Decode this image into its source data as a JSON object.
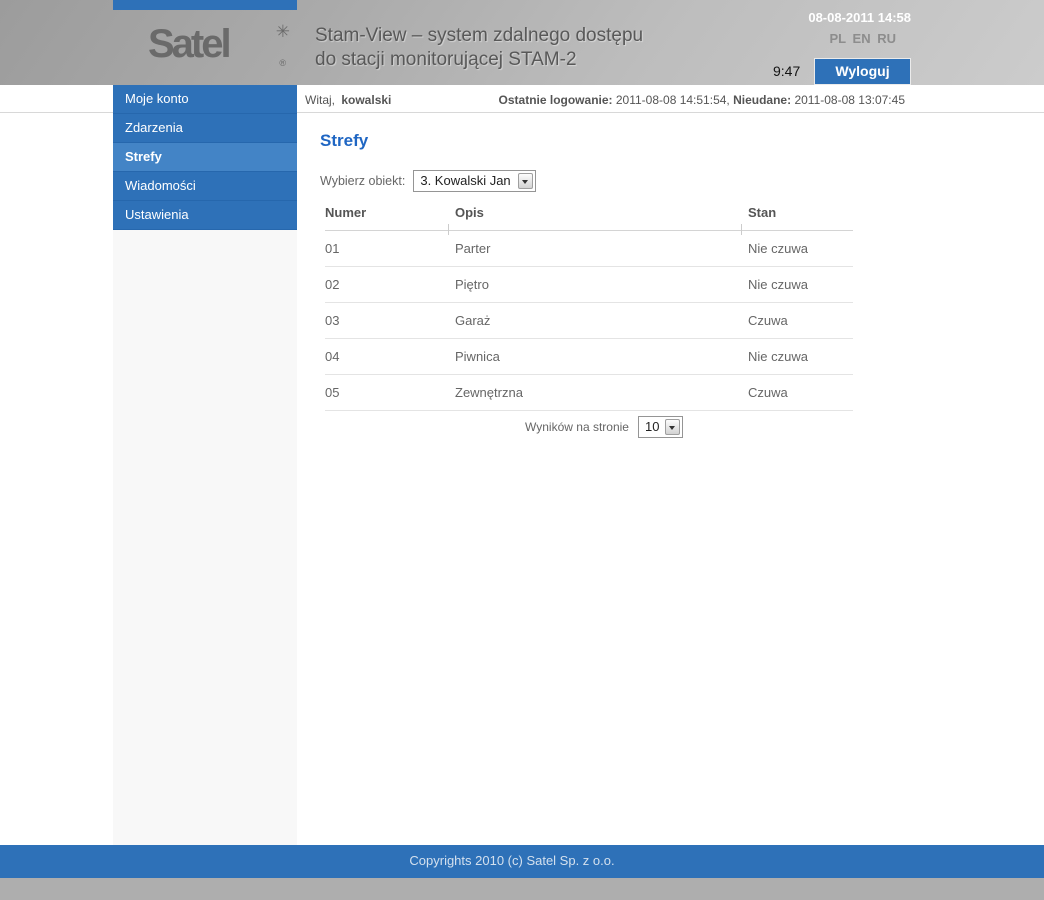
{
  "header": {
    "logo_text": "Satel",
    "logo_asterisk": "✳",
    "logo_registered": "®",
    "title_line1": "Stam-View – system zdalnego dostępu",
    "title_line2": "do stacji monitorującej STAM-2",
    "datetime": "08-08-2011 14:58",
    "languages": [
      "PL",
      "EN",
      "RU"
    ],
    "session_timer": "9:47",
    "logout_label": "Wyloguj"
  },
  "welcome": {
    "greeting_prefix": "Witaj,",
    "username": "kowalski",
    "last_login_label": "Ostatnie logowanie:",
    "last_login_value": "2011-08-08 14:51:54,",
    "failed_label": "Nieudane:",
    "failed_value": "2011-08-08 13:07:45"
  },
  "sidebar": {
    "items": [
      {
        "label": "Moje konto"
      },
      {
        "label": "Zdarzenia"
      },
      {
        "label": "Strefy"
      },
      {
        "label": "Wiadomości"
      },
      {
        "label": "Ustawienia"
      }
    ],
    "active_item": "Strefy"
  },
  "main": {
    "page_title": "Strefy",
    "object_select_label": "Wybierz obiekt:",
    "object_select_value": "3. Kowalski Jan",
    "table": {
      "columns": [
        "Numer",
        "Opis",
        "Stan"
      ],
      "rows": [
        {
          "numer": "01",
          "opis": "Parter",
          "stan": "Nie czuwa"
        },
        {
          "numer": "02",
          "opis": "Piętro",
          "stan": "Nie czuwa"
        },
        {
          "numer": "03",
          "opis": "Garaż",
          "stan": "Czuwa"
        },
        {
          "numer": "04",
          "opis": "Piwnica",
          "stan": "Nie czuwa"
        },
        {
          "numer": "05",
          "opis": "Zewnętrzna",
          "stan": "Czuwa"
        }
      ]
    },
    "per_page_label": "Wyników na stronie",
    "per_page_value": "10"
  },
  "footer": {
    "copyright": "Copyrights 2010 (c) Satel Sp. z o.o."
  },
  "colors": {
    "primary_blue": "#2e71b8",
    "active_item_blue": "#4384c6",
    "heading_blue": "#1f66c3",
    "header_gray": "#b3b3b3",
    "bottom_strip_gray": "#aeaeae"
  }
}
